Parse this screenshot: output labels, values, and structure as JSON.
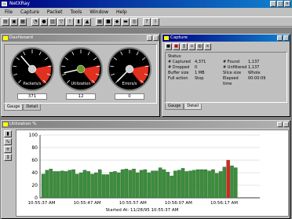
{
  "window": {
    "title": "NetXRay"
  },
  "menu": [
    "File",
    "Capture",
    "Packet",
    "Tools",
    "Window",
    "Help"
  ],
  "toolbar": {
    "groups": [
      [
        "open-icon",
        "save-icon",
        "print-icon"
      ],
      [
        "dashboard-icon",
        "capture-icon",
        "detail-icon",
        "filter-icon",
        "alarm-icon",
        "stats-icon",
        "chart-icon"
      ],
      [
        "matrix-icon",
        "host-icon",
        "protocol-icon",
        "history-icon",
        "netmap-icon"
      ],
      [
        "help-icon",
        "about-icon"
      ]
    ]
  },
  "dashboard": {
    "title": "Dashboard",
    "gauges": [
      {
        "name": "Packets/s",
        "value": "371",
        "level": 0.35
      },
      {
        "name": "Utilization",
        "value": "12",
        "level": 0.12
      },
      {
        "name": "Errors/s",
        "value": "0",
        "level": 0.0
      }
    ],
    "tabs": [
      "Gauge",
      "Detail"
    ]
  },
  "captures": {
    "title": "Capture",
    "status_label": "Status:",
    "rows": [
      {
        "k1": "# Captured",
        "v1": "4,371",
        "k2": "# Found",
        "v2": "1,137"
      },
      {
        "k1": "# Dropped",
        "v1": "0",
        "k2": "# Unfiltered",
        "v2": "1,137"
      },
      {
        "k1": "Buffer size",
        "v1": "1 MB",
        "k2": "Slice size",
        "v2": "Whole"
      },
      {
        "k1": "Full action",
        "v1": "Stop",
        "k2": "Elapsed time",
        "v2": "00:00:09"
      }
    ],
    "toolbar": [
      "stop-icon",
      "play-icon",
      "pause-icon",
      "binoculars-icon",
      "view-icon",
      "close-icon"
    ],
    "tabs": [
      "Gauge",
      "Detail"
    ]
  },
  "history": {
    "title": "Utilization %",
    "side_buttons": [
      "bar-icon",
      "line-icon",
      "zoom-icon",
      "scroll-icon"
    ]
  },
  "chart_data": {
    "type": "bar",
    "ylim": [
      0,
      100
    ],
    "yticks": [
      0,
      20,
      40,
      60,
      80,
      100
    ],
    "x_tick_labels": [
      "10:55:37 AM",
      "10:55:47 AM",
      "10:55:57 AM",
      "10:56:07 AM",
      "10:56:17 AM"
    ],
    "xlabel": "Started At: 11/28/95 10:55:37 AM",
    "values": [
      38,
      44,
      46,
      42,
      42,
      43,
      42,
      44,
      45,
      38,
      40,
      44,
      42,
      38,
      40,
      45,
      37,
      37,
      41,
      42,
      40,
      45,
      46,
      44,
      46,
      40,
      44,
      45,
      40,
      43,
      43,
      48,
      45,
      41,
      35,
      43,
      44,
      47,
      42,
      43,
      44,
      45,
      45,
      45,
      43,
      45,
      39,
      42,
      49,
      60,
      51,
      48
    ],
    "highlight_index": 49,
    "colors": {
      "bar": "#3c8c3c",
      "highlight": "#e02020"
    }
  }
}
